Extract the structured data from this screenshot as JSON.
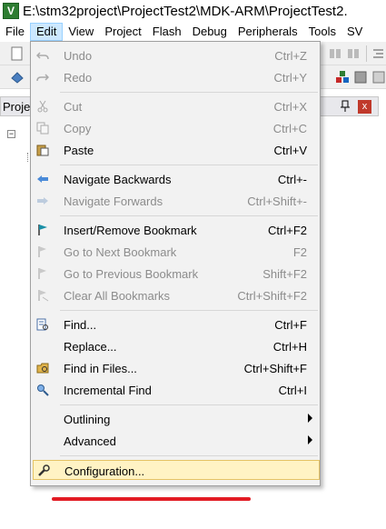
{
  "title_bar": {
    "app_icon_glyph": "V",
    "title": "E:\\stm32project\\ProjectTest2\\MDK-ARM\\ProjectTest2."
  },
  "menubar": {
    "items": [
      "File",
      "Edit",
      "View",
      "Project",
      "Flash",
      "Debug",
      "Peripherals",
      "Tools",
      "SV"
    ],
    "active": "Edit"
  },
  "project_panel": {
    "title": "Proje",
    "pin_glyph": "📌",
    "close_glyph": "x",
    "expander_glyph": "−"
  },
  "edit_menu": {
    "undo": {
      "label": "Undo",
      "shortcut": "Ctrl+Z"
    },
    "redo": {
      "label": "Redo",
      "shortcut": "Ctrl+Y"
    },
    "cut": {
      "label": "Cut",
      "shortcut": "Ctrl+X"
    },
    "copy": {
      "label": "Copy",
      "shortcut": "Ctrl+C"
    },
    "paste": {
      "label": "Paste",
      "shortcut": "Ctrl+V"
    },
    "navigate_backwards": {
      "label": "Navigate Backwards",
      "shortcut": "Ctrl+-"
    },
    "navigate_forwards": {
      "label": "Navigate Forwards",
      "shortcut": "Ctrl+Shift+-"
    },
    "insert_remove_bookmark": {
      "label": "Insert/Remove Bookmark",
      "shortcut": "Ctrl+F2"
    },
    "go_to_next_bookmark": {
      "label": "Go to Next Bookmark",
      "shortcut": "F2"
    },
    "go_to_previous_bookmark": {
      "label": "Go to Previous Bookmark",
      "shortcut": "Shift+F2"
    },
    "clear_all_bookmarks": {
      "label": "Clear All Bookmarks",
      "shortcut": "Ctrl+Shift+F2"
    },
    "find": {
      "label": "Find...",
      "shortcut": "Ctrl+F"
    },
    "replace": {
      "label": "Replace...",
      "shortcut": "Ctrl+H"
    },
    "find_in_files": {
      "label": "Find in Files...",
      "shortcut": "Ctrl+Shift+F"
    },
    "incremental_find": {
      "label": "Incremental Find",
      "shortcut": "Ctrl+I"
    },
    "outlining": {
      "label": "Outlining"
    },
    "advanced": {
      "label": "Advanced"
    },
    "configuration": {
      "label": "Configuration..."
    }
  },
  "colors": {
    "highlight": "#fff3c4",
    "annotation_underline": "#e21b24",
    "menu_active": "#cce8ff"
  }
}
